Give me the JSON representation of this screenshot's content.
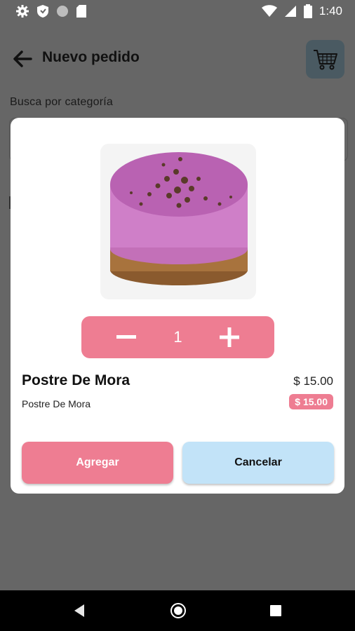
{
  "status_bar": {
    "time": "1:40",
    "left_icons": [
      "gear-icon",
      "shield-icon",
      "circle-icon",
      "sd-card-icon"
    ],
    "right_icons": [
      "wifi-icon",
      "signal-icon",
      "battery-icon"
    ]
  },
  "header": {
    "title": "Nuevo pedido",
    "back_icon": "arrow-left-icon",
    "cart_icon": "shopping-cart-icon",
    "cart_color": "#4a5a62"
  },
  "search": {
    "category_label": "Busca por categoría"
  },
  "dialog": {
    "image_icon": "cake-photo",
    "quantity": "1",
    "product_name": "Postre De Mora",
    "product_description": "Postre De Mora",
    "price": "$ 15.00",
    "price_badge": "$ 15.00",
    "add_label": "Agregar",
    "cancel_label": "Cancelar"
  },
  "colors": {
    "accent_pink": "#ee7d92",
    "cancel_blue": "#c2e3f8",
    "overlay": "#666666"
  },
  "nav_bar": {
    "icons": [
      "nav-back-icon",
      "nav-home-icon",
      "nav-recent-icon"
    ]
  }
}
